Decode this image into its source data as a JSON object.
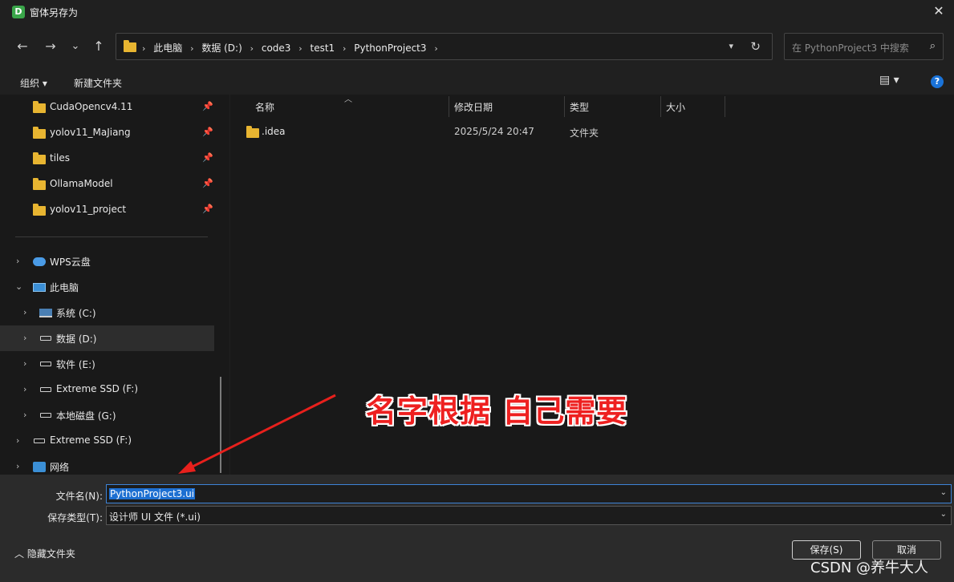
{
  "window": {
    "title": "窗体另存为",
    "app_icon_letter": "D",
    "close_glyph": "✕"
  },
  "nav": {
    "back": "←",
    "forward": "→",
    "recent": "⌄",
    "up": "↑"
  },
  "address": {
    "crumbs": [
      "此电脑",
      "数据 (D:)",
      "code3",
      "test1",
      "PythonProject3"
    ],
    "separator": "›"
  },
  "search": {
    "placeholder": "在 PythonProject3 中搜索"
  },
  "toolbar": {
    "organize": "组织 ▾",
    "new_folder": "新建文件夹",
    "view_glyph": "▤ ▾",
    "help_glyph": "?"
  },
  "sidebar": {
    "quick": [
      {
        "label": "CudaOpencv4.11"
      },
      {
        "label": "yolov11_MaJiang"
      },
      {
        "label": "tiles"
      },
      {
        "label": "OllamaModel"
      },
      {
        "label": "yolov11_project"
      }
    ],
    "tree": [
      {
        "label": "WPS云盘"
      },
      {
        "label": "此电脑"
      },
      {
        "label": "系统 (C:)"
      },
      {
        "label": "数据 (D:)"
      },
      {
        "label": "软件 (E:)"
      },
      {
        "label": "Extreme SSD (F:)"
      },
      {
        "label": "本地磁盘 (G:)"
      },
      {
        "label": "Extreme SSD (F:)"
      },
      {
        "label": "网络"
      }
    ]
  },
  "columns": {
    "name": "名称",
    "modified": "修改日期",
    "type": "类型",
    "size": "大小"
  },
  "files": [
    {
      "name": ".idea",
      "modified": "2025/5/24 20:47",
      "type": "文件夹"
    }
  ],
  "form": {
    "filename_label": "文件名(N):",
    "filename_value": "PythonProject3.ui",
    "filetype_label": "保存类型(T):",
    "filetype_value": "设计师 UI 文件 (*.ui)"
  },
  "footer": {
    "hide_folders": "隐藏文件夹",
    "save": "保存(S)",
    "cancel": "取消"
  },
  "annotation": {
    "text": "名字根据 自己需要",
    "color": "#ee2020"
  },
  "watermark": "CSDN @养牛大人"
}
